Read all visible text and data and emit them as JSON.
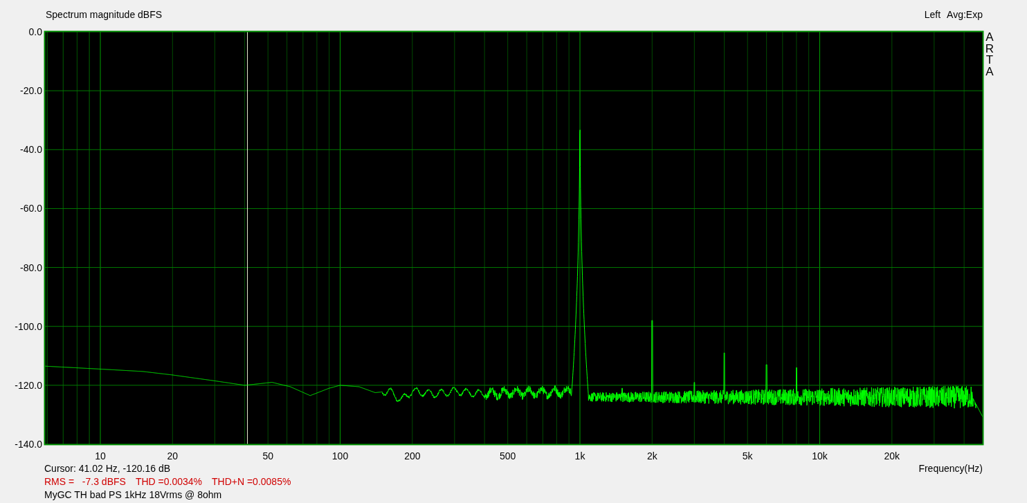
{
  "header": {
    "title": "Spectrum magnitude dBFS",
    "channel": "Left",
    "averaging": "Avg:Exp"
  },
  "logo": "ARTA",
  "y_axis": {
    "ticks": [
      "0.0",
      "-20.0",
      "-40.0",
      "-60.0",
      "-80.0",
      "-100.0",
      "-120.0",
      "-140.0"
    ]
  },
  "x_axis": {
    "ticks": [
      "10",
      "20",
      "50",
      "100",
      "200",
      "500",
      "1k",
      "2k",
      "5k",
      "10k",
      "20k"
    ],
    "label": "Frequency(Hz)"
  },
  "cursor": {
    "readout": "Cursor: 41.02 Hz, -120.16 dB"
  },
  "measurements": [
    "RMS =   -7.3 dBFS",
    "THD =0.0034%",
    "THD+N =0.0085%"
  ],
  "measurement_name": "MyGC TH bad PS 1kHz 18Vrms @ 8ohm"
}
